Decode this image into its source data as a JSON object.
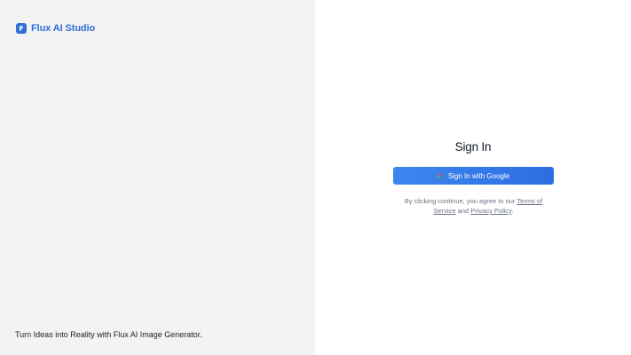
{
  "brand": {
    "name": "Flux AI Studio",
    "icon": "flux-logo-icon",
    "color": "#2f6fd6"
  },
  "left_panel": {
    "tagline": "Turn Ideas into Reality with Flux AI Image Generator.",
    "background": "#f3f3f3"
  },
  "signin": {
    "title": "Sign In",
    "google_button_label": "Sign In with Google",
    "google_icon": "google-icon",
    "button_color": "#3579e8",
    "terms_prefix": "By clicking continue, you agree to our ",
    "terms_link": "Terms of Service",
    "terms_and": " and ",
    "privacy_link": "Privacy Policy",
    "terms_suffix": "."
  }
}
